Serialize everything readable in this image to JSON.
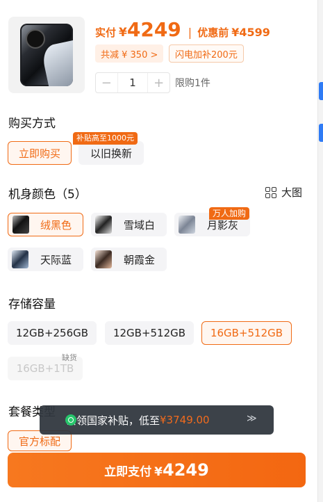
{
  "product": {
    "actual_label": "实付",
    "currency": "¥",
    "actual_price": "4249",
    "separator": "|",
    "original_label": "优惠前",
    "original_price": "¥4599"
  },
  "discounts": [
    "共减 ¥ 350 >",
    "闪电加补200元"
  ],
  "quantity": {
    "minus": "−",
    "value": "1",
    "plus": "+",
    "limit": "限购1件"
  },
  "purchase": {
    "title": "购买方式",
    "options": [
      "立即购买",
      "以旧换新"
    ],
    "badge": "补贴高至1000元"
  },
  "color": {
    "title": "机身颜色（5）",
    "bigview_label": "大图",
    "options": [
      "绒黑色",
      "雪域白",
      "月影灰",
      "天际蓝",
      "朝霞金"
    ],
    "badge": "万人加购"
  },
  "storage": {
    "title": "存储容量",
    "options": [
      "12GB+256GB",
      "12GB+512GB",
      "16GB+512GB",
      "16GB+1TB"
    ],
    "out_of_stock": "缺货"
  },
  "package": {
    "title": "套餐类型",
    "option": "官方标配"
  },
  "toast": {
    "text": "去领国家补贴，低至",
    "price": "¥3749.00",
    "chevron": "≫"
  },
  "pay": {
    "label": "立即支付",
    "currency": "¥",
    "amount": "4249"
  },
  "colors": {
    "accent": "#f06a14",
    "toast_bg": "#30363e"
  }
}
